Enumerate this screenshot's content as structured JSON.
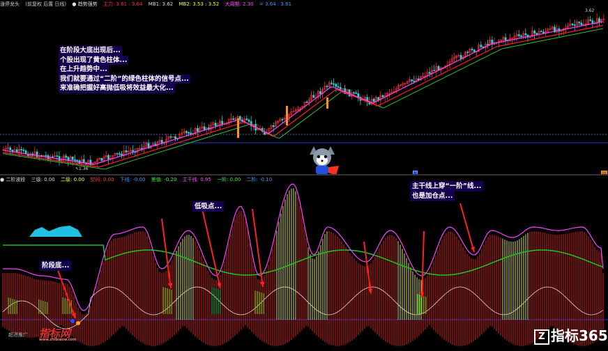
{
  "top_header": {
    "symbol": "涨停龙头",
    "section": "(前复权 后置 日线)",
    "indicator": "● 趋势强势",
    "values": [
      {
        "label": "主力: 3.61 : 3.64",
        "color": "#ff3030"
      },
      {
        "label": "MB1: 3.62",
        "color": "#dddddd"
      },
      {
        "label": "MB2: 3.53 : 3.52",
        "color": "#ffff30"
      },
      {
        "label": "大周期: 2.30",
        "color": "#ff50ff"
      },
      {
        "label": "= 3.64 : 3.61",
        "color": "#30a0ff"
      }
    ]
  },
  "price_labels": {
    "high": "3.62",
    "low": "↖1.36"
  },
  "note": {
    "lines": [
      "在阶段大底出现后...",
      "个股出现了黄色柱体...",
      "在上升趋势中...",
      "我们就要通过“二阶”的绿色柱体的信号点...",
      "来准确把握好高抛低吸将效益最大化..."
    ]
  },
  "bottom_header": {
    "indicator": "● 二阶波段",
    "values": [
      {
        "label": "三级: 0.00",
        "color": "#dddddd"
      },
      {
        "label": "二级: 0.00",
        "color": "#ffff30"
      },
      {
        "label": "空间: 0.00",
        "color": "#ff4040"
      },
      {
        "label": "下线: -0.00",
        "color": "#30a0ff"
      },
      {
        "label": "差值: -0.20",
        "color": "#30ff30"
      },
      {
        "label": "主干线: 0.95",
        "color": "#ff50ff"
      },
      {
        "label": "一阶: 0.00",
        "color": "#30ff30"
      },
      {
        "label": "二阶: -0.10",
        "color": "#30a0ff"
      }
    ]
  },
  "annotations": {
    "stage_bottom": "阶段底...",
    "low_buy": "低吸点...",
    "main_line_1": "主干线上穿“一阶”线...",
    "main_line_2": "也是加仓点..."
  },
  "watermarks": {
    "left_brand": "指标网",
    "left_url": "www.zhibiaow.com",
    "right_brand": "指标365",
    "bottom_left": "超进推广"
  },
  "colors": {
    "up_candle": "#ff3030",
    "down_candle": "#30d0d0",
    "ma_red": "#ff2020",
    "ma_purple": "#ff40ff",
    "ma_green": "#30c030",
    "bar_red": "#ff2020",
    "bar_yellow": "#ffff60",
    "bar_green": "#30d030",
    "line_green": "#20c020",
    "line_magenta": "#ff40ff",
    "line_white": "#e0e0e0",
    "cyan_fill": "#20c0e0",
    "annotation_bg": "#18005a",
    "arrow": "#ff2020"
  }
}
